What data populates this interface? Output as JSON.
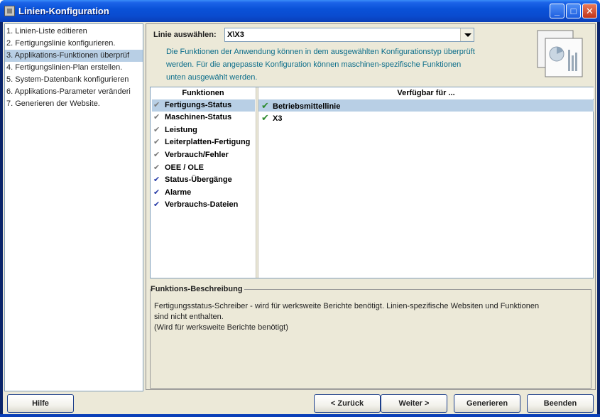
{
  "window": {
    "title": "Linien-Konfiguration"
  },
  "steps": [
    "1. Linien-Liste editieren",
    "2. Fertigungslinie konfigurieren.",
    "3. Applikations-Funktionen überprüf",
    "4. Fertigungslinien-Plan erstellen.",
    "5. System-Datenbank konfigurieren",
    "6. Applikations-Parameter veränderi",
    "7. Generieren der Website."
  ],
  "header": {
    "line_label": "Linie auswählen:",
    "line_value": "X\\X3",
    "description": "Die Funktionen der Anwendung können in dem ausgewählten Konfigurationstyp überprüft werden. Für die angepasste Konfiguration können maschinen-spezifische Funktionen unten ausgewählt werden."
  },
  "functions": {
    "col_functions": "Funktionen",
    "col_available": "Verfügbar für ...",
    "items": [
      "Fertigungs-Status",
      "Maschinen-Status",
      "Leistung",
      "Leiterplatten-Fertigung",
      "Verbrauch/Fehler",
      "OEE / OLE",
      "Status-Übergänge",
      "Alarme",
      "Verbrauchs-Dateien"
    ],
    "available": [
      "Betriebsmittellinie",
      "X3"
    ]
  },
  "description_box": {
    "legend": "Funktions-Beschreibung",
    "line1": "Fertigungsstatus-Schreiber - wird für werksweite Berichte benötigt. Linien-spezifische Websiten und Funktionen",
    "line2": "sind nicht enthalten.",
    "line3": "(Wird für werksweite Berichte benötigt)"
  },
  "buttons": {
    "help": "Hilfe",
    "back": "< Zurück",
    "next": "Weiter >",
    "generate": "Generieren",
    "finish": "Beenden"
  },
  "icons": {
    "checked": "✔"
  },
  "colors": {
    "selection": "#b8cfe5",
    "accent": "#0a52d8",
    "info_text": "#0b6d8a",
    "check_green": "#2e8b2e"
  }
}
